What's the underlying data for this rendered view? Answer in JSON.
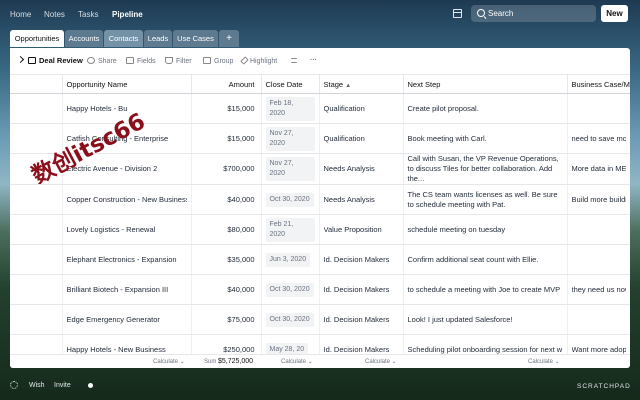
{
  "nav": {
    "items": [
      "Home",
      "Notes",
      "Tasks",
      "Pipeline"
    ],
    "active": "Pipeline"
  },
  "search": {
    "placeholder": "Search"
  },
  "new_button": "New",
  "tabs": [
    {
      "label": "Opportunities",
      "active": true
    },
    {
      "label": "Accounts"
    },
    {
      "label": "Contacts",
      "highlight": true
    },
    {
      "label": "Leads"
    },
    {
      "label": "Use Cases"
    },
    {
      "label": "+"
    }
  ],
  "toolbar": {
    "view": "Deal Review",
    "share": "Share",
    "fields": "Fields",
    "filter": "Filter",
    "group": "Group",
    "highlight": "Highlight",
    "more": "···"
  },
  "columns": [
    "Opportunity Name",
    "Amount",
    "Close Date",
    "Stage",
    "Next Step",
    "Business Case/Me"
  ],
  "rows": [
    {
      "name": "Happy Hotels - Bu",
      "amount": "$15,000",
      "date": "Feb 18, 2020",
      "stage": "Qualification",
      "next": "Create pilot proposal.",
      "biz": ""
    },
    {
      "name": "Catfish Consulting - Enterprise",
      "amount": "$15,000",
      "date": "Nov 27, 2020",
      "stage": "Qualification",
      "next": "Book meeting with Carl.",
      "biz": "need to save more"
    },
    {
      "name": "Electric Avenue - Division 2",
      "amount": "$700,000",
      "date": "Nov 27, 2020",
      "stage": "Needs Analysis",
      "next": "Call with Susan, the VP Revenue Operations, to discuss Tiles for better collaboration. Add the...",
      "biz": "More data in MEU"
    },
    {
      "name": "Copper Construction - New Business",
      "amount": "$40,000",
      "date": "Oct 30, 2020",
      "stage": "Needs Analysis",
      "next": "The CS team wants licenses as well. Be sure to schedule meeting with Pat.",
      "biz": "Build more buildin"
    },
    {
      "name": "Lovely Logistics - Renewal",
      "amount": "$80,000",
      "date": "Feb 21, 2020",
      "stage": "Value Proposition",
      "next": "schedule meeting on tuesday",
      "biz": ""
    },
    {
      "name": "Elephant Electronics - Expansion",
      "amount": "$35,000",
      "date": "Jun 3, 2020",
      "stage": "Id. Decision Makers",
      "next": "Confirm additional seat count with Ellie.",
      "biz": ""
    },
    {
      "name": "Brilliant Biotech - Expansion III",
      "amount": "$40,000",
      "date": "Oct 30, 2020",
      "stage": "Id. Decision Makers",
      "next": "to schedule a meeting with Joe to create MVP",
      "biz": "they need us now"
    },
    {
      "name": "Edge Emergency Generator",
      "amount": "$75,000",
      "date": "Oct 30, 2020",
      "stage": "Id. Decision Makers",
      "next": "Look! I just updated Salesforce!",
      "biz": ""
    },
    {
      "name": "Happy Hotels - New Business",
      "amount": "$250,000",
      "date": "May 28, 20",
      "stage": "Id. Decision Makers",
      "next": "Scheduling pilot onboarding session for next w",
      "biz": "Want more adoptio"
    }
  ],
  "footer": {
    "calc": "Calculate ⌄",
    "sum_label": "Sum",
    "sum_value": "$5,725,000"
  },
  "bottom": {
    "wish": "Wish",
    "invite": "Invite",
    "brand": "SCRATCHPAD"
  },
  "watermark": "数创itsc66",
  "colors": {
    "accent": "#ffffff",
    "watermark": "#8b0f1a"
  }
}
